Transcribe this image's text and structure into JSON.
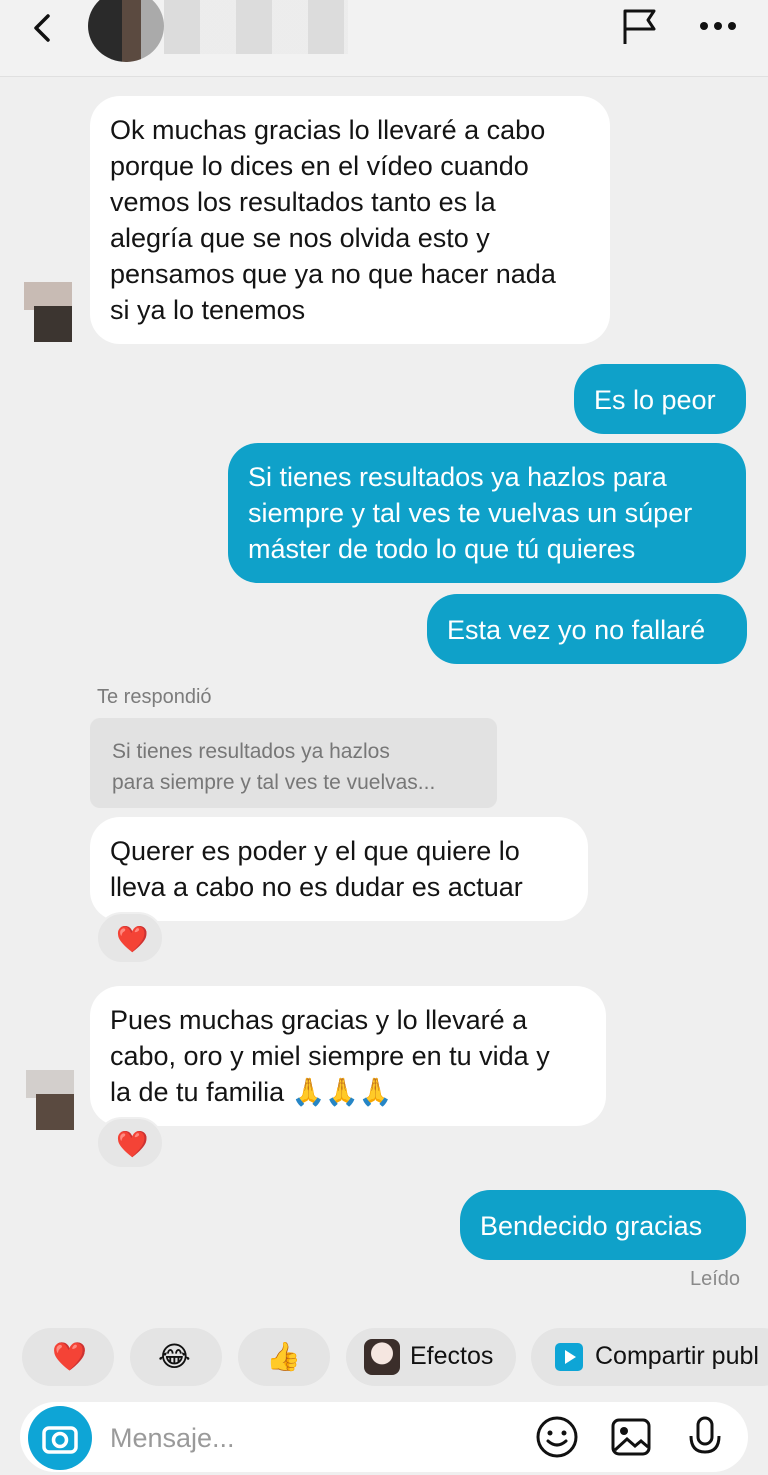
{
  "header": {
    "back_icon": "chevron-left-icon",
    "flag_icon": "flag-icon",
    "more_icon": "more-horizontal-icon"
  },
  "messages": [
    {
      "side": "in",
      "text": "Ok muchas gracias lo llevaré a cabo\nporque lo dices en el vídeo cuando\nvemos los resultados tanto es la\nalegría que se nos olvida esto y\npensamos que ya no que hacer nada\nsi ya lo tenemos"
    },
    {
      "side": "out",
      "text": "Es lo peor"
    },
    {
      "side": "out",
      "text": "Si tienes resultados ya hazlos para\nsiempre y tal ves te vuelvas un súper\nmáster de todo lo que tú quieres"
    },
    {
      "side": "out",
      "text": "Esta vez yo no fallaré"
    },
    {
      "side": "in",
      "text": "Querer es poder y el que quiere lo\nlleva a cabo no es dudar es actuar"
    },
    {
      "side": "in",
      "text": "Pues muchas gracias y lo llevaré a\ncabo, oro y miel siempre en tu vida y\nla de tu familia 🙏🙏🙏"
    },
    {
      "side": "out",
      "text": "Bendecido gracias"
    }
  ],
  "reply": {
    "label": "Te respondió",
    "quote": "Si tienes resultados ya hazlos\npara siempre y tal ves te vuelvas..."
  },
  "reactions": {
    "heart": "❤️"
  },
  "status": {
    "read": "Leído"
  },
  "quick_chips": [
    {
      "emoji": "❤️"
    },
    {
      "emoji": "😂"
    },
    {
      "emoji": "👍"
    },
    {
      "emoji": "",
      "label": "Efectos"
    },
    {
      "emoji": "",
      "label": "Compartir publ"
    }
  ],
  "composer": {
    "placeholder": "Mensaje...",
    "camera_icon": "camera-icon",
    "sticker_icon": "sticker-icon",
    "image_icon": "image-icon",
    "mic_icon": "microphone-icon"
  },
  "colors": {
    "outgoing_bubble": "#0fa1c9",
    "incoming_bubble": "#ffffff",
    "background": "#efefef"
  }
}
